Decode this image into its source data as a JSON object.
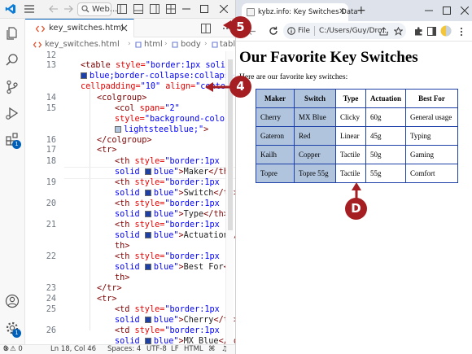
{
  "vscode": {
    "search_text": "Web...",
    "tab": {
      "filename": "key_switches.html"
    },
    "breadcrumb": [
      "key_switches.html",
      "html",
      "body",
      "table",
      "t"
    ],
    "activity_badges": {
      "extensions": "1",
      "manage": "1"
    },
    "lines": [
      {
        "num": "12"
      },
      {
        "num": "13"
      },
      {
        "num": ""
      },
      {
        "num": ""
      },
      {
        "num": "14"
      },
      {
        "num": "15"
      },
      {
        "num": ""
      },
      {
        "num": ""
      },
      {
        "num": "16"
      },
      {
        "num": "17"
      },
      {
        "num": "18"
      },
      {
        "num": ""
      },
      {
        "num": "19"
      },
      {
        "num": ""
      },
      {
        "num": "20"
      },
      {
        "num": ""
      },
      {
        "num": "21"
      },
      {
        "num": ""
      },
      {
        "num": ""
      },
      {
        "num": "22"
      },
      {
        "num": ""
      },
      {
        "num": ""
      },
      {
        "num": "23"
      },
      {
        "num": "24"
      },
      {
        "num": "25"
      },
      {
        "num": ""
      },
      {
        "num": "26"
      },
      {
        "num": ""
      }
    ],
    "code": {
      "l13a_tag": "<table",
      "l13a_attr": " style=",
      "l13a_val": "\"border:1px solid",
      "l13b_val": "blue;border-collapse:collapse\"",
      "l13c_attr": "cellpadding=",
      "l13c_val1": "\"10\"",
      "l13c_attr2": " align=",
      "l13c_val2": "\"center\"",
      "l13c_tag": ">",
      "l14": "<colgroup>",
      "l15a_tag": "<col",
      "l15a_attr": " span=",
      "l15a_val": "\"2\"",
      "l15b_attr": "style=",
      "l15b_val": "\"background-color:",
      "l15c_val": "lightsteelblue;\"",
      "l15c_tag": ">",
      "l16": "</colgroup>",
      "l17": "<tr>",
      "th_open": "<th",
      "style_attr": " style=",
      "border_val": "\"border:1px",
      "solid_text": "solid ",
      "blue_val": "blue\"",
      "th1_text": "Maker",
      "th2_text": "Switch",
      "th3_text": "Type",
      "th4_text": "Actuation",
      "th5_text": "Best For",
      "th_close": "</th>",
      "th_close_a": "</",
      "th_close_b": "th>",
      "tr_close": "</tr>",
      "td_open": "<td",
      "td1_text": "Cherry",
      "td2_text": "MX Blue",
      "td_close": "</td>"
    },
    "status": {
      "problems": "0 ⚠ 0",
      "position": "Ln 18, Col 46",
      "spaces": "Spaces: 4",
      "encoding": "UTF-8",
      "eol": "LF",
      "language": "HTML"
    }
  },
  "browser": {
    "tab_title": "kybz.info: Key Switches Data",
    "omnibox": {
      "scheme": "File",
      "url": "C:/Users/Guy/Dro..."
    },
    "page": {
      "heading": "Our Favorite Key Switches",
      "intro": "Here are our favorite key switches:",
      "table": {
        "headers": [
          "Maker",
          "Switch",
          "Type",
          "Actuation",
          "Best For"
        ],
        "rows": [
          [
            "Cherry",
            "MX Blue",
            "Clicky",
            "60g",
            "General usage"
          ],
          [
            "Gateron",
            "Red",
            "Linear",
            "45g",
            "Typing"
          ],
          [
            "Kailh",
            "Copper",
            "Tactile",
            "50g",
            "Gaming"
          ],
          [
            "Topre",
            "Topre 55g",
            "Tactile",
            "55g",
            "Comfort"
          ]
        ]
      }
    }
  },
  "callouts": {
    "c4": "4",
    "c5": "5",
    "cD": "D"
  },
  "colors": {
    "callout": "#a41e22",
    "table_border": "#1c3fa8",
    "col_bg": "#b0c4de",
    "accent": "#005fb8"
  }
}
